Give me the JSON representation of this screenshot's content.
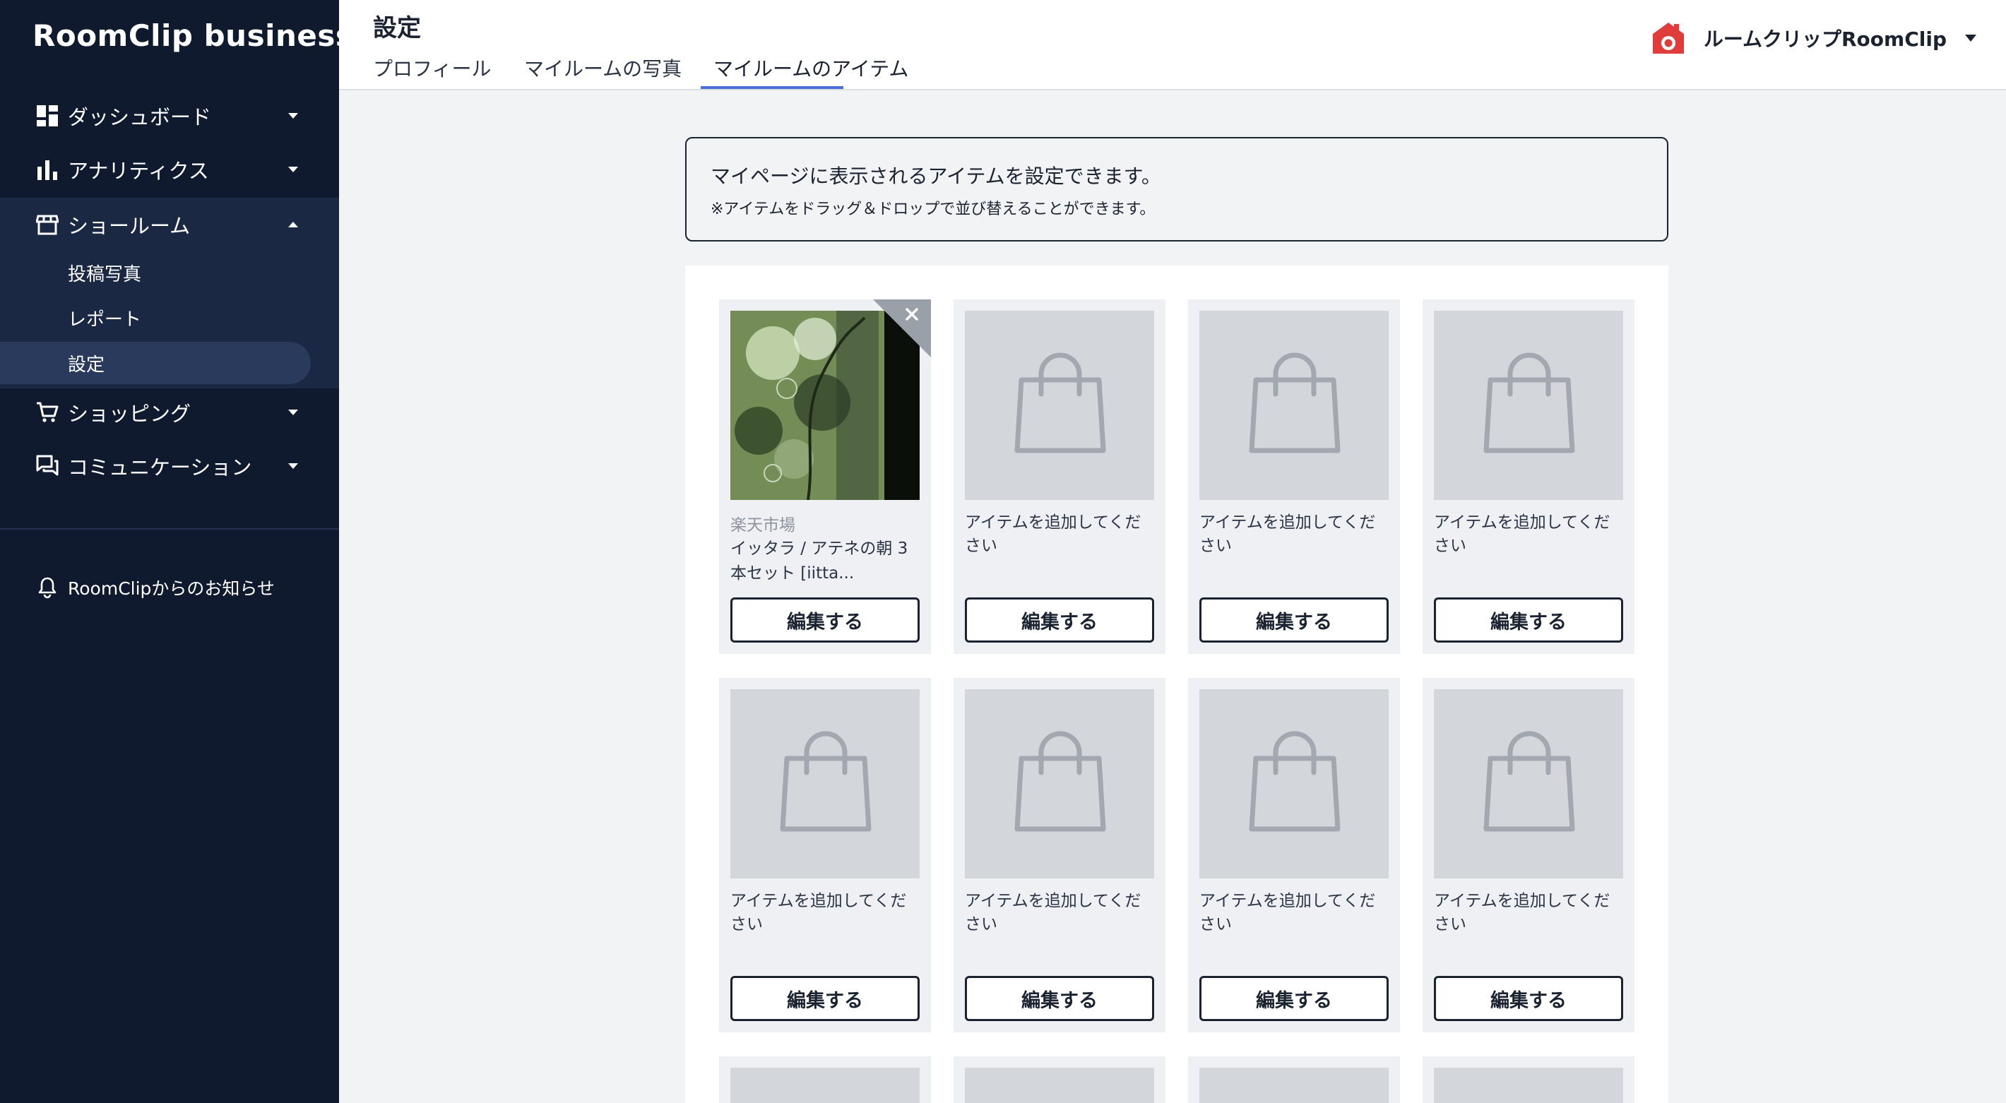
{
  "brand": {
    "logo_text": "RoomClip business"
  },
  "sidebar": {
    "items": [
      {
        "label": "ダッシュボード",
        "icon": "dashboard-icon"
      },
      {
        "label": "アナリティクス",
        "icon": "bar-chart-icon"
      },
      {
        "label": "ショールーム",
        "icon": "storefront-icon"
      },
      {
        "label": "ショッピング",
        "icon": "cart-icon"
      },
      {
        "label": "コミュニケーション",
        "icon": "chat-icon"
      }
    ],
    "showroom_sub": [
      {
        "label": "投稿写真"
      },
      {
        "label": "レポート"
      },
      {
        "label": "設定"
      }
    ],
    "notice_label": "RoomClipからのお知らせ"
  },
  "header": {
    "title": "設定",
    "tabs": [
      {
        "label": "プロフィール"
      },
      {
        "label": "マイルームの写真"
      },
      {
        "label": "マイルームのアイテム"
      }
    ],
    "account_name": "ルームクリップRoomClip"
  },
  "info": {
    "main": "マイページに表示されるアイテムを設定できます。",
    "sub": "※アイテムをドラッグ＆ドロップで並び替えることができます。"
  },
  "items": [
    {
      "store": "楽天市場",
      "name": "イッタラ / アテネの朝 3本セット [iitta...",
      "edit_label": "編集する"
    },
    {
      "prompt": "アイテムを追加してください",
      "edit_label": "編集する"
    },
    {
      "prompt": "アイテムを追加してください",
      "edit_label": "編集する"
    },
    {
      "prompt": "アイテムを追加してください",
      "edit_label": "編集する"
    },
    {
      "prompt": "アイテムを追加してください",
      "edit_label": "編集する"
    },
    {
      "prompt": "アイテムを追加してください",
      "edit_label": "編集する"
    },
    {
      "prompt": "アイテムを追加してください",
      "edit_label": "編集する"
    },
    {
      "prompt": "アイテムを追加してください",
      "edit_label": "編集する"
    }
  ],
  "colors": {
    "sidebar_bg": "#0f1a2e",
    "sidebar_active": "#2a3a5c",
    "tab_accent": "#4a6fd8",
    "brand_red": "#e03c3c"
  }
}
